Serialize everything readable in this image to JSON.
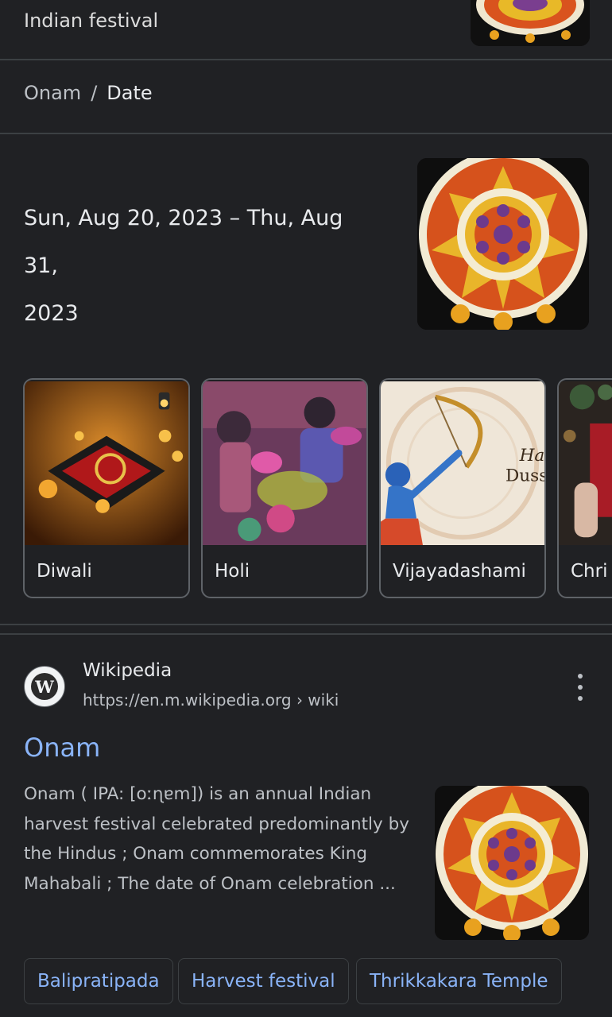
{
  "header": {
    "subtitle": "Indian festival",
    "breadcrumb": {
      "parent": "Onam",
      "separator": "/",
      "current": "Date"
    }
  },
  "date_answer": {
    "line1": "Sun, Aug 20, 2023 – Thu, Aug 31,",
    "line2": "2023"
  },
  "related_festivals": [
    {
      "label": "Diwali"
    },
    {
      "label": "Holi"
    },
    {
      "label": "Vijayadashami",
      "image_text_1": "Hap",
      "image_text_2": "Duss"
    },
    {
      "label": "Chri"
    }
  ],
  "result": {
    "site_name": "Wikipedia",
    "logo_letter": "W",
    "url": "https://en.m.wikipedia.org › wiki",
    "title": "Onam",
    "snippet": "Onam ( IPA: [oːɳɐm]) is an annual Indian harvest festival celebrated predominantly by the Hindus ; Onam commemorates King Mahabali ; The date of Onam celebration ...",
    "chips": [
      "Balipratipada",
      "Harvest festival",
      "Thrikkakara Temple"
    ]
  },
  "colors": {
    "background": "#202124",
    "link": "#8ab4f8",
    "text": "#e8eaed",
    "muted": "#bdc1c6",
    "divider": "#3c4043"
  }
}
